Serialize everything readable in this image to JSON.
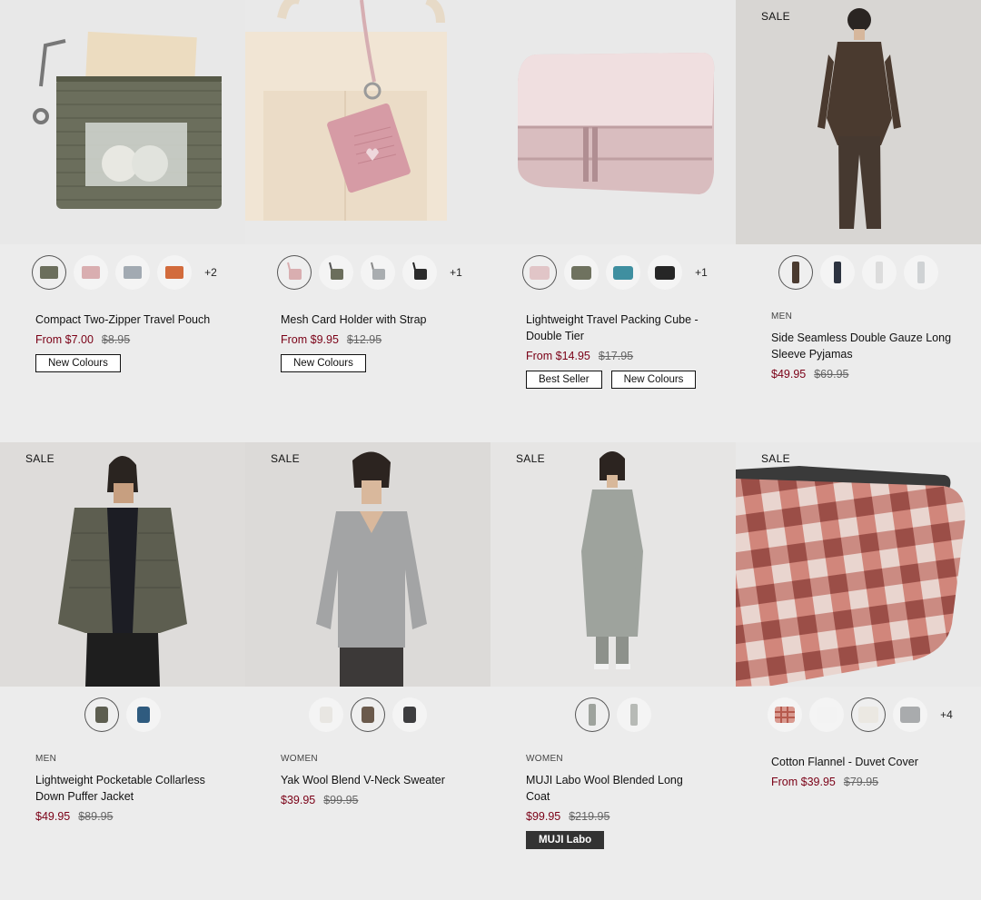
{
  "sale_label": "SALE",
  "products": [
    {
      "category": "",
      "name": "Compact Two-Zipper Travel Pouch",
      "price": "From $7.00",
      "old_price": "$8.95",
      "badges": [
        "New Colours"
      ],
      "swatches": [
        "khaki",
        "pink",
        "grey-blue",
        "orange"
      ],
      "more": "+2",
      "sale": false
    },
    {
      "category": "",
      "name": "Mesh Card Holder with Strap",
      "price": "From $9.95",
      "old_price": "$12.95",
      "badges": [
        "New Colours"
      ],
      "swatches": [
        "pink",
        "khaki",
        "grey",
        "black"
      ],
      "more": "+1",
      "sale": false
    },
    {
      "category": "",
      "name": "Lightweight Travel Packing Cube - Double Tier",
      "price": "From $14.95",
      "old_price": "$17.95",
      "badges": [
        "Best Seller",
        "New Colours"
      ],
      "swatches": [
        "pink",
        "khaki",
        "teal",
        "black"
      ],
      "more": "+1",
      "sale": false
    },
    {
      "category": "MEN",
      "name": "Side Seamless Double Gauze Long Sleeve Pyjamas",
      "price": "$49.95",
      "old_price": "$69.95",
      "badges": [],
      "swatches": [
        "brown",
        "navy",
        "white",
        "light-grey"
      ],
      "more": "",
      "sale": true
    },
    {
      "category": "MEN",
      "name": "Lightweight Pocketable Collarless Down Puffer Jacket",
      "price": "$49.95",
      "old_price": "$89.95",
      "badges": [],
      "swatches": [
        "khaki",
        "blue"
      ],
      "more": "",
      "sale": true
    },
    {
      "category": "WOMEN",
      "name": "Yak Wool Blend V-Neck Sweater",
      "price": "$39.95",
      "old_price": "$99.95",
      "badges": [],
      "swatches": [
        "off-white",
        "brown",
        "charcoal"
      ],
      "more": "",
      "sale": true
    },
    {
      "category": "WOMEN",
      "name": "MUJI Labo Wool Blended Long Coat",
      "price": "$99.95",
      "old_price": "$219.95",
      "badges_dark": [
        "MUJI Labo"
      ],
      "badges": [],
      "swatches": [
        "grey",
        "light-grey"
      ],
      "more": "",
      "sale": true
    },
    {
      "category": "",
      "name": "Cotton Flannel - Duvet Cover",
      "price": "From $39.95",
      "old_price": "$79.95",
      "badges": [],
      "swatches": [
        "red-check",
        "white",
        "off-white",
        "grey"
      ],
      "more": "+4",
      "sale": true
    }
  ]
}
